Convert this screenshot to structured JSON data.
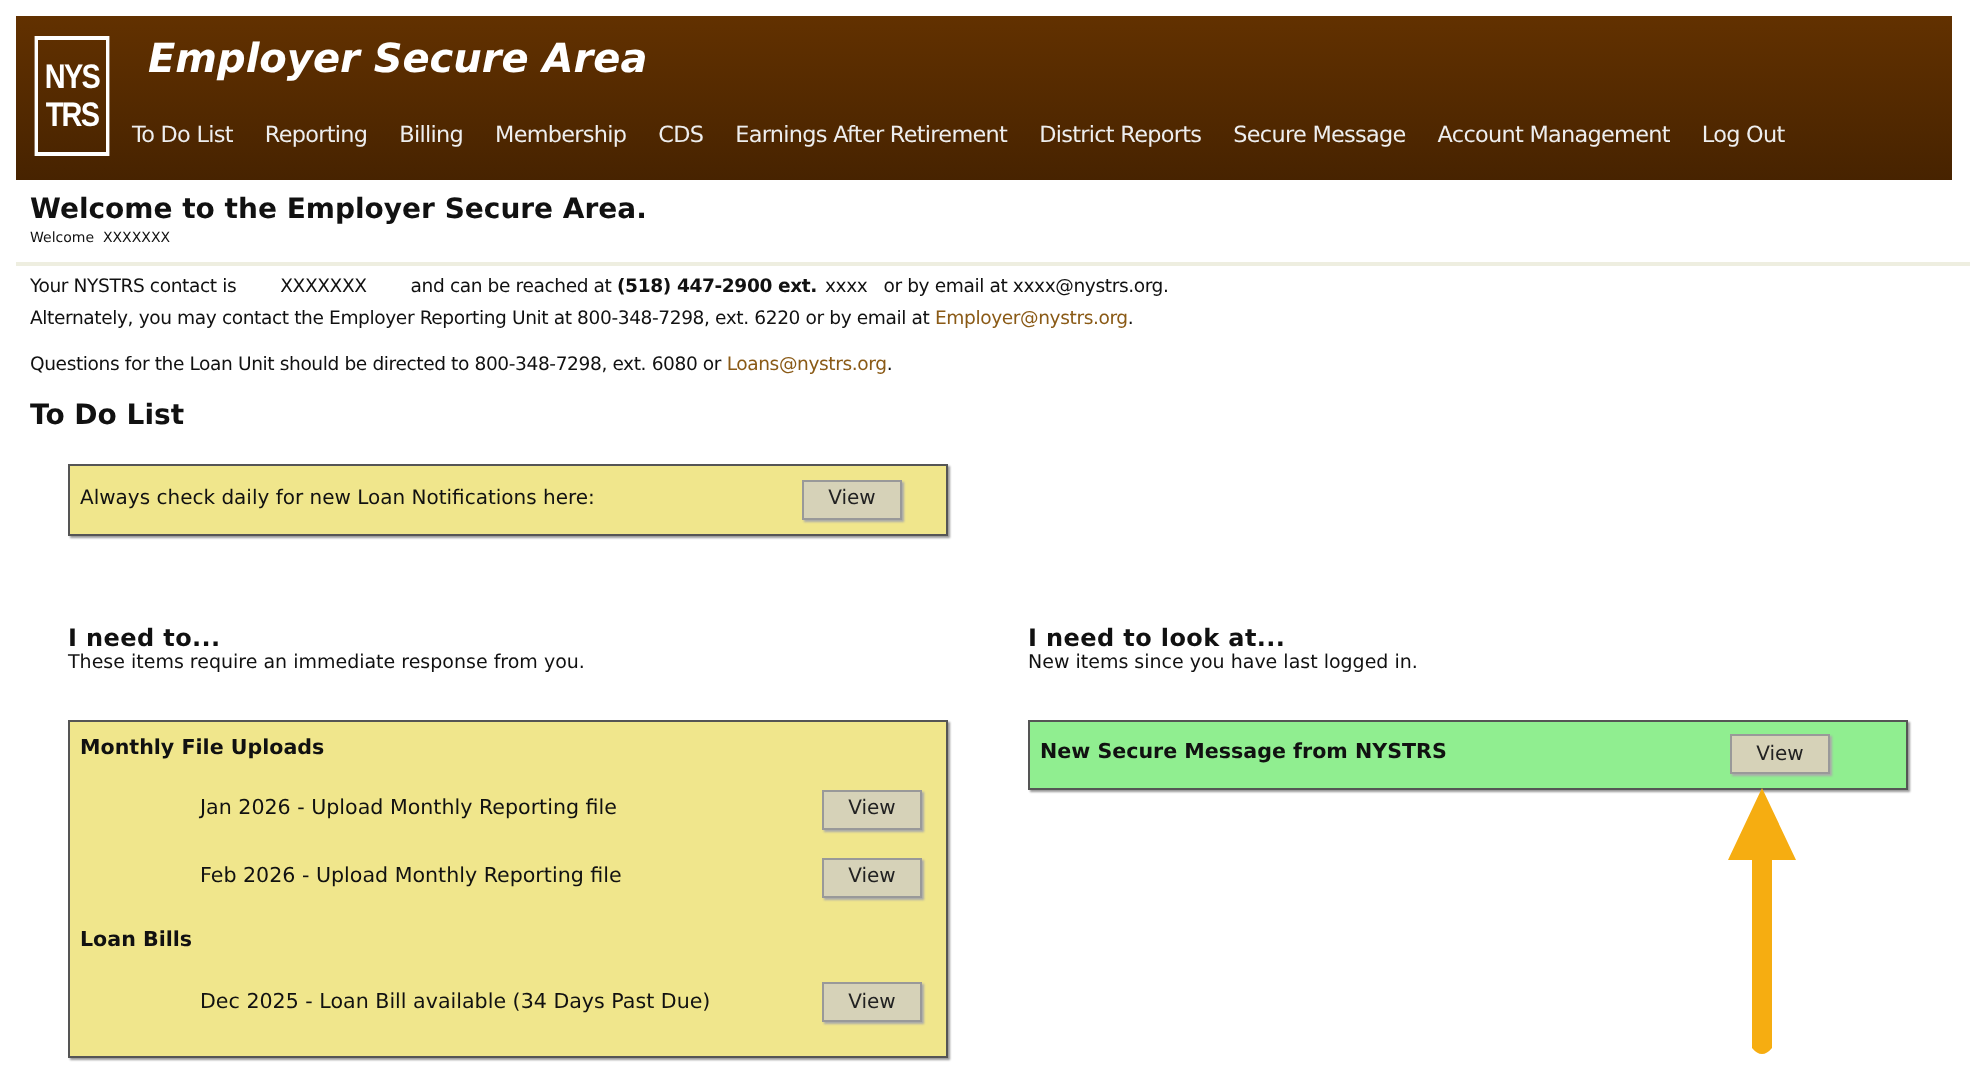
{
  "header": {
    "logo_lines": [
      "NYS",
      "TRS"
    ],
    "title": "Employer Secure Area",
    "nav": [
      "To Do List",
      "Reporting",
      "Billing",
      "Membership",
      "CDS",
      "Earnings After Retirement",
      "District Reports",
      "Secure Message",
      "Account Management",
      "Log Out"
    ]
  },
  "welcome": {
    "heading": "Welcome to the Employer Secure Area.",
    "subtext": "Welcome  XXXXXXX"
  },
  "contact": [
    [
      {
        "kind": "text",
        "text": "Your NYSTRS contact is"
      },
      {
        "kind": "field",
        "text": "XXXXXXX"
      },
      {
        "kind": "text",
        "text": "and can be reached at "
      },
      {
        "kind": "bold",
        "text": "(518) 447-2900 ext."
      },
      {
        "kind": "field_small",
        "text": "xxxx"
      },
      {
        "kind": "text",
        "text": "or by email at xxxx@nystrs.org."
      }
    ],
    [
      {
        "kind": "text",
        "text": "Alternately, you may contact the Employer Reporting Unit at 800-348-7298, ext. 6220 or by email at "
      },
      {
        "kind": "link",
        "text": "Employer@nystrs.org"
      },
      {
        "kind": "text",
        "text": "."
      }
    ],
    [
      {
        "kind": "text",
        "text": "Questions for the Loan Unit should be directed to 800-348-7298, ext. 6080 or "
      },
      {
        "kind": "link",
        "text": "Loans@nystrs.org"
      },
      {
        "kind": "text",
        "text": "."
      }
    ]
  ],
  "todo": {
    "heading": "To Do List",
    "notice": {
      "text": "Always check daily for new Loan Notifications here:",
      "button": "View"
    },
    "need_to": {
      "heading": "I need to...",
      "subtext": "These items require an immediate response from you.",
      "groups": [
        {
          "title": "Monthly File Uploads",
          "items": [
            {
              "text": "Jan 2026 - Upload Monthly Reporting file",
              "button": "View"
            },
            {
              "text": "Feb 2026 - Upload Monthly Reporting file",
              "button": "View"
            }
          ]
        },
        {
          "title": "Loan Bills",
          "items": [
            {
              "text": "Dec 2025 - Loan Bill available (34 Days Past Due)",
              "button": "View"
            }
          ]
        }
      ]
    },
    "look_at": {
      "heading": "I need to look at...",
      "subtext": "New items since you have last logged in.",
      "items": [
        {
          "text": "New Secure Message from NYSTRS",
          "button": "View"
        }
      ]
    }
  }
}
